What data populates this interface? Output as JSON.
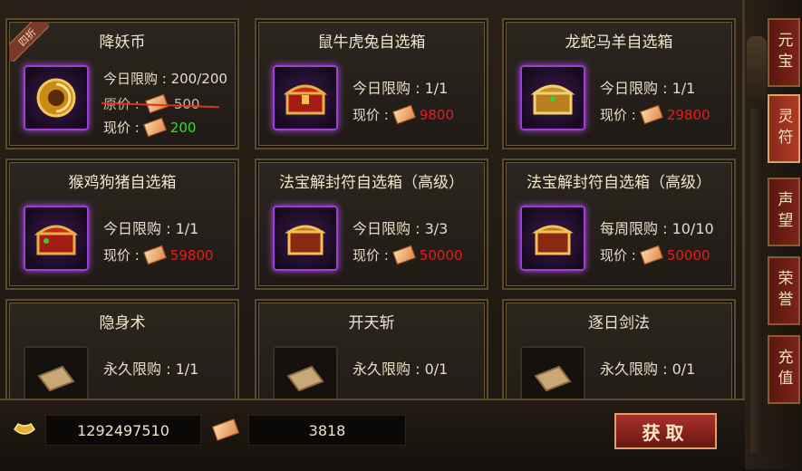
{
  "cards": [
    {
      "title": "降妖币",
      "badge": "四折",
      "limit_label": "今日限购 : 200/200",
      "old_label": "原价 :",
      "old_price": "500",
      "now_label": "现价 :",
      "now_price": "200",
      "price_color": "green",
      "icon": "gold-coin-icon",
      "purple": true
    },
    {
      "title": "鼠牛虎兔自选箱",
      "limit_label": "今日限购 : 1/1",
      "now_label": "现价 :",
      "now_price": "9800",
      "price_color": "red",
      "icon": "red-chest-icon",
      "purple": true
    },
    {
      "title": "龙蛇马羊自选箱",
      "limit_label": "今日限购 : 1/1",
      "now_label": "现价 :",
      "now_price": "29800",
      "price_color": "red",
      "icon": "gold-chest-icon",
      "purple": true
    },
    {
      "title": "猴鸡狗猪自选箱",
      "limit_label": "今日限购 : 1/1",
      "now_label": "现价 :",
      "now_price": "59800",
      "price_color": "red",
      "icon": "red-chest-icon",
      "purple": true
    },
    {
      "title": "法宝解封符自选箱（高级）",
      "limit_label": "今日限购 : 3/3",
      "now_label": "现价 :",
      "now_price": "50000",
      "price_color": "red",
      "icon": "gold-chest-icon",
      "purple": true
    },
    {
      "title": "法宝解封符自选箱（高级）",
      "limit_label": "每周限购 : 10/10",
      "now_label": "现价 :",
      "now_price": "50000",
      "price_color": "red",
      "icon": "gold-chest-icon",
      "purple": true
    },
    {
      "title": "隐身术",
      "limit_label": "永久限购 : 1/1",
      "icon": "scroll-book-icon",
      "purple": false
    },
    {
      "title": "开天斩",
      "limit_label": "永久限购 : 0/1",
      "icon": "scroll-book-icon",
      "purple": false
    },
    {
      "title": "逐日剑法",
      "limit_label": "永久限购 : 0/1",
      "icon": "scroll-book-icon",
      "purple": false
    }
  ],
  "bottom": {
    "gold_value": "1292497510",
    "ticket_value": "3818",
    "get_button": "获取"
  },
  "tabs": [
    {
      "label": "元宝",
      "active": false
    },
    {
      "label": "灵符",
      "active": true
    },
    {
      "label": "声望",
      "active": false
    },
    {
      "label": "荣誉",
      "active": false
    },
    {
      "label": "充值",
      "active": false
    }
  ]
}
